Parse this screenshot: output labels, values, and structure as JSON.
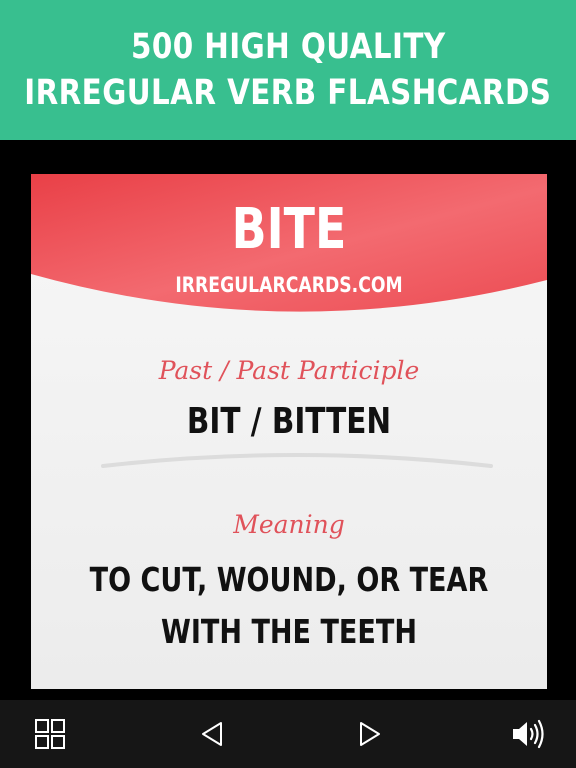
{
  "banner": {
    "line1": "500 HIGH QUALITY",
    "line2": "IRREGULAR VERB FLASHCARDS"
  },
  "card": {
    "verb": "BITE",
    "site": "IRREGULARCARDS.COM",
    "past_label": "Past / Past Participle",
    "past_value": "BIT / BITTEN",
    "meaning_label": "Meaning",
    "meaning_line1": "TO CUT, WOUND, OR TEAR",
    "meaning_line2": "WITH THE TEETH"
  },
  "colors": {
    "banner": "#38bf8f",
    "card_header": "#ee4b52",
    "accent_text": "#e0525a",
    "toolbar": "#161616"
  },
  "toolbar": {
    "icons": [
      "grid-icon",
      "previous-icon",
      "next-icon",
      "speaker-icon"
    ]
  }
}
